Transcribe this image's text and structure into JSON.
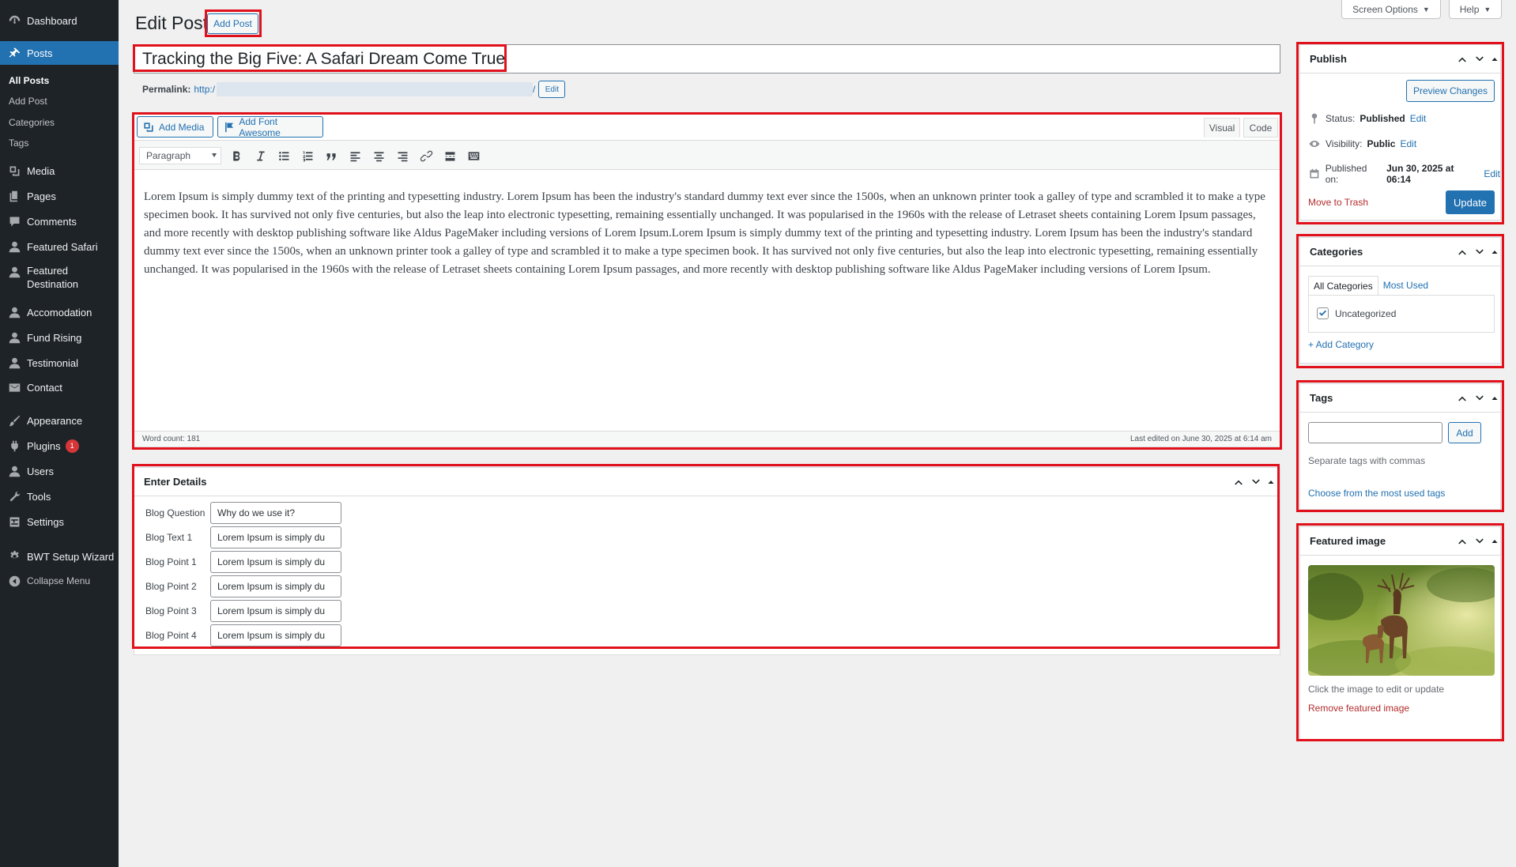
{
  "sidebar": {
    "items": [
      {
        "label": "Dashboard",
        "icon": "dashboard-icon"
      },
      {
        "label": "Posts",
        "icon": "pin-icon"
      },
      {
        "label": "Media",
        "icon": "media-icon"
      },
      {
        "label": "Pages",
        "icon": "pages-icon"
      },
      {
        "label": "Comments",
        "icon": "comments-icon"
      },
      {
        "label": "Featured Safari",
        "icon": "user-icon"
      },
      {
        "label": "Featured Destination",
        "icon": "user-icon"
      },
      {
        "label": "Accomodation",
        "icon": "user-icon"
      },
      {
        "label": "Fund Rising",
        "icon": "user-icon"
      },
      {
        "label": "Testimonial",
        "icon": "user-icon"
      },
      {
        "label": "Contact",
        "icon": "mail-icon"
      },
      {
        "label": "Appearance",
        "icon": "brush-icon"
      },
      {
        "label": "Plugins",
        "icon": "plugin-icon",
        "badge": "1"
      },
      {
        "label": "Users",
        "icon": "users-icon"
      },
      {
        "label": "Tools",
        "icon": "wrench-icon"
      },
      {
        "label": "Settings",
        "icon": "settings-icon"
      },
      {
        "label": "BWT Setup Wizard",
        "icon": "gear-icon"
      },
      {
        "label": "Collapse Menu",
        "icon": "collapse-icon"
      }
    ],
    "posts_submenu": [
      "All Posts",
      "Add Post",
      "Categories",
      "Tags"
    ]
  },
  "header": {
    "title": "Edit Post",
    "add_post_label": "Add Post",
    "screen_options_label": "Screen Options",
    "help_label": "Help"
  },
  "post": {
    "title": "Tracking the Big Five: A Safari Dream Come True",
    "permalink_label": "Permalink:",
    "permalink_url": "http:/",
    "permalink_suffix": "/",
    "permalink_edit_label": "Edit"
  },
  "editor": {
    "add_media_label": "Add Media",
    "add_font_awesome_label": "Add Font Awesome",
    "tab_visual": "Visual",
    "tab_code": "Code",
    "format_value": "Paragraph",
    "content": "Lorem Ipsum is simply dummy text of the printing and typesetting industry. Lorem Ipsum has been the industry's standard dummy text ever since the 1500s, when an unknown printer took a galley of type and scrambled it to make a type specimen book. It has survived not only five centuries, but also the leap into electronic typesetting, remaining essentially unchanged. It was popularised in the 1960s with the release of Letraset sheets containing Lorem Ipsum passages, and more recently with desktop publishing software like Aldus PageMaker including versions of Lorem Ipsum.Lorem Ipsum is simply dummy text of the printing and typesetting industry. Lorem Ipsum has been the industry's standard dummy text ever since the 1500s, when an unknown printer took a galley of type and scrambled it to make a type specimen book. It has survived not only five centuries, but also the leap into electronic typesetting, remaining essentially unchanged. It was popularised in the 1960s with the release of Letraset sheets containing Lorem Ipsum passages, and more recently with desktop publishing software like Aldus PageMaker including versions of Lorem Ipsum.",
    "word_count": "Word count: 181",
    "last_edited": "Last edited on June 30, 2025 at 6:14 am"
  },
  "details": {
    "title": "Enter Details",
    "fields": [
      {
        "label": "Blog Question",
        "value": "Why do we use it?"
      },
      {
        "label": "Blog Text 1",
        "value": "Lorem Ipsum is simply du"
      },
      {
        "label": "Blog Point 1",
        "value": "Lorem Ipsum is simply du"
      },
      {
        "label": "Blog Point 2",
        "value": "Lorem Ipsum is simply du"
      },
      {
        "label": "Blog Point 3",
        "value": "Lorem Ipsum is simply du"
      },
      {
        "label": "Blog Point 4",
        "value": "Lorem Ipsum is simply du"
      }
    ]
  },
  "publish": {
    "title": "Publish",
    "preview_label": "Preview Changes",
    "status_label": "Status:",
    "status_value": "Published",
    "visibility_label": "Visibility:",
    "visibility_value": "Public",
    "published_label": "Published on:",
    "published_value": "Jun 30, 2025 at 06:14",
    "edit_label": "Edit",
    "trash_label": "Move to Trash",
    "update_label": "Update"
  },
  "categories": {
    "title": "Categories",
    "tab_all": "All Categories",
    "tab_most_used": "Most Used",
    "items": [
      {
        "label": "Uncategorized",
        "checked": true
      }
    ],
    "add_label": "+ Add Category"
  },
  "tags": {
    "title": "Tags",
    "input_value": "",
    "add_label": "Add",
    "hint": "Separate tags with commas",
    "choose_label": "Choose from the most used tags"
  },
  "featured_image": {
    "title": "Featured image",
    "hint": "Click the image to edit or update",
    "remove_label": "Remove featured image"
  },
  "colors": {
    "sidebar_bg": "#1d2327",
    "accent": "#2271b1",
    "highlight_box": "#e0111b",
    "badge": "#d63638"
  }
}
